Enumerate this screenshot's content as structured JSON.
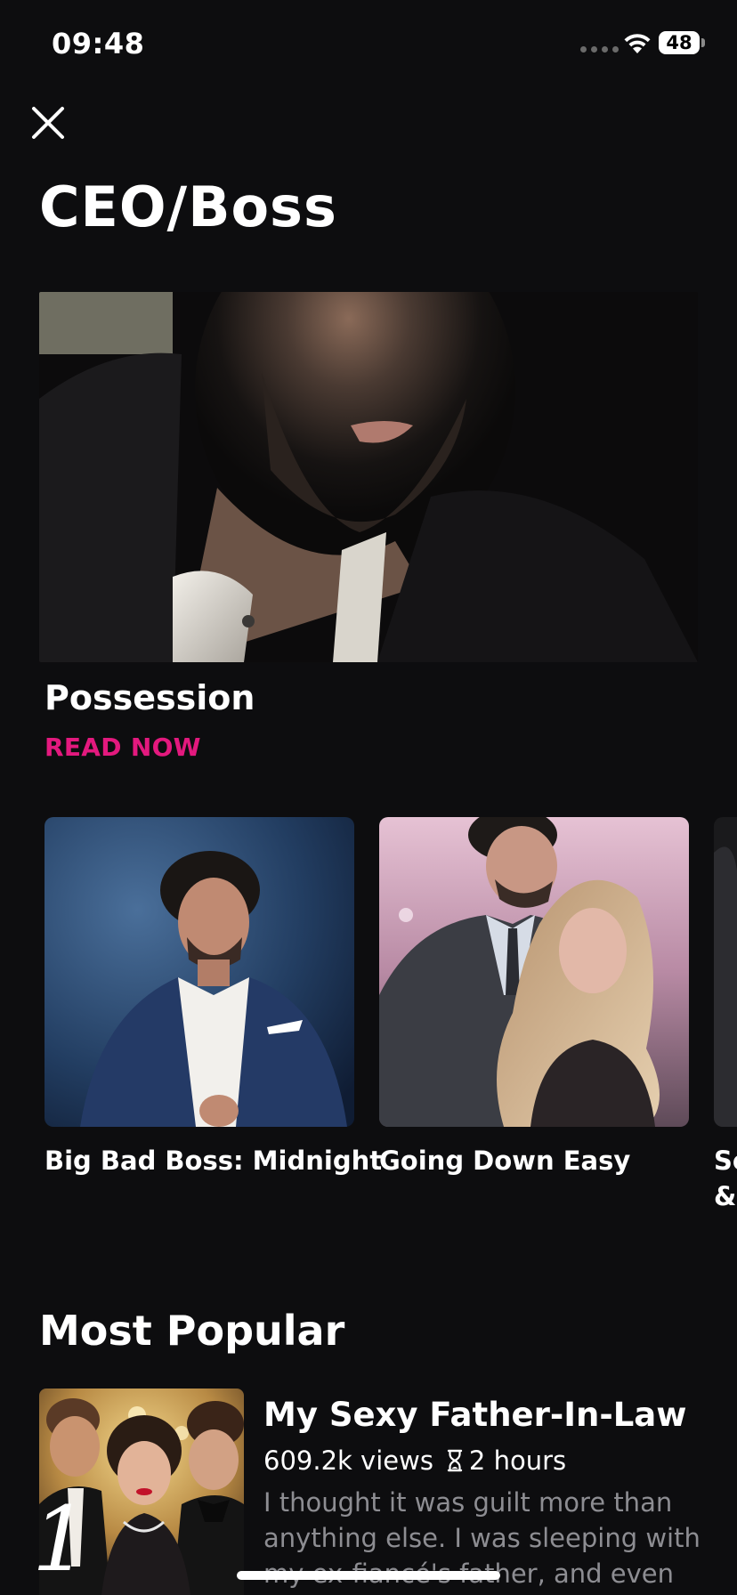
{
  "status_bar": {
    "time": "09:48",
    "battery": "48"
  },
  "header": {
    "close_icon": "close-icon",
    "title": "CEO/Boss"
  },
  "featured": {
    "title": "Possession",
    "cta": "READ NOW"
  },
  "carousel": {
    "items": [
      {
        "title": "Big Bad Boss: Midnight"
      },
      {
        "title": "Going Down Easy"
      },
      {
        "title": "Se\n&"
      }
    ]
  },
  "most_popular": {
    "section_title": "Most Popular",
    "items": [
      {
        "rank": "1",
        "title": "My Sexy Father-In-Law",
        "views": "609.2k views",
        "duration": "2 hours",
        "description": "I thought it was guilt more than anything else. I was sleeping with my ex-fiancé's father, and even"
      }
    ]
  },
  "colors": {
    "background": "#0d0d0f",
    "accent": "#e3197e",
    "muted_text": "#8d8d92"
  }
}
